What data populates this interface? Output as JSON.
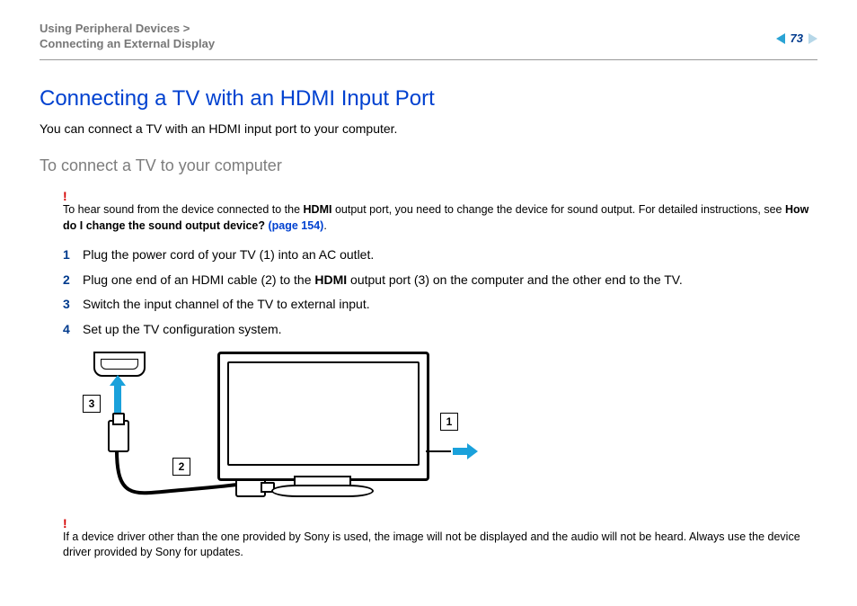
{
  "breadcrumb": {
    "line1_a": "Using Peripheral Devices",
    "sep": ">",
    "line2": "Connecting an External Display"
  },
  "page_number": "73",
  "heading": "Connecting a TV with an HDMI Input Port",
  "intro": "You can connect a TV with an HDMI input port to your computer.",
  "subheading": "To connect a TV to your computer",
  "note1": {
    "bang": "!",
    "t1": "To hear sound from the device connected to the ",
    "bold1": "HDMI",
    "t2": " output port, you need to change the device for sound output. For detailed instructions, see ",
    "bold2": "How do I change the sound output device? ",
    "link": "(page 154)",
    "t3": "."
  },
  "steps": {
    "s1": "Plug the power cord of your TV (1) into an AC outlet.",
    "s2a": "Plug one end of an HDMI cable (2) to the ",
    "s2b": "HDMI",
    "s2c": " output port (3) on the computer and the other end to the TV.",
    "s3": "Switch the input channel of the TV to external input.",
    "s4": "Set up the TV configuration system."
  },
  "callouts": {
    "c1": "1",
    "c2": "2",
    "c3": "3"
  },
  "note2": {
    "bang": "!",
    "text": "If a device driver other than the one provided by Sony is used, the image will not be displayed and the audio will not be heard. Always use the device driver provided by Sony for updates."
  }
}
